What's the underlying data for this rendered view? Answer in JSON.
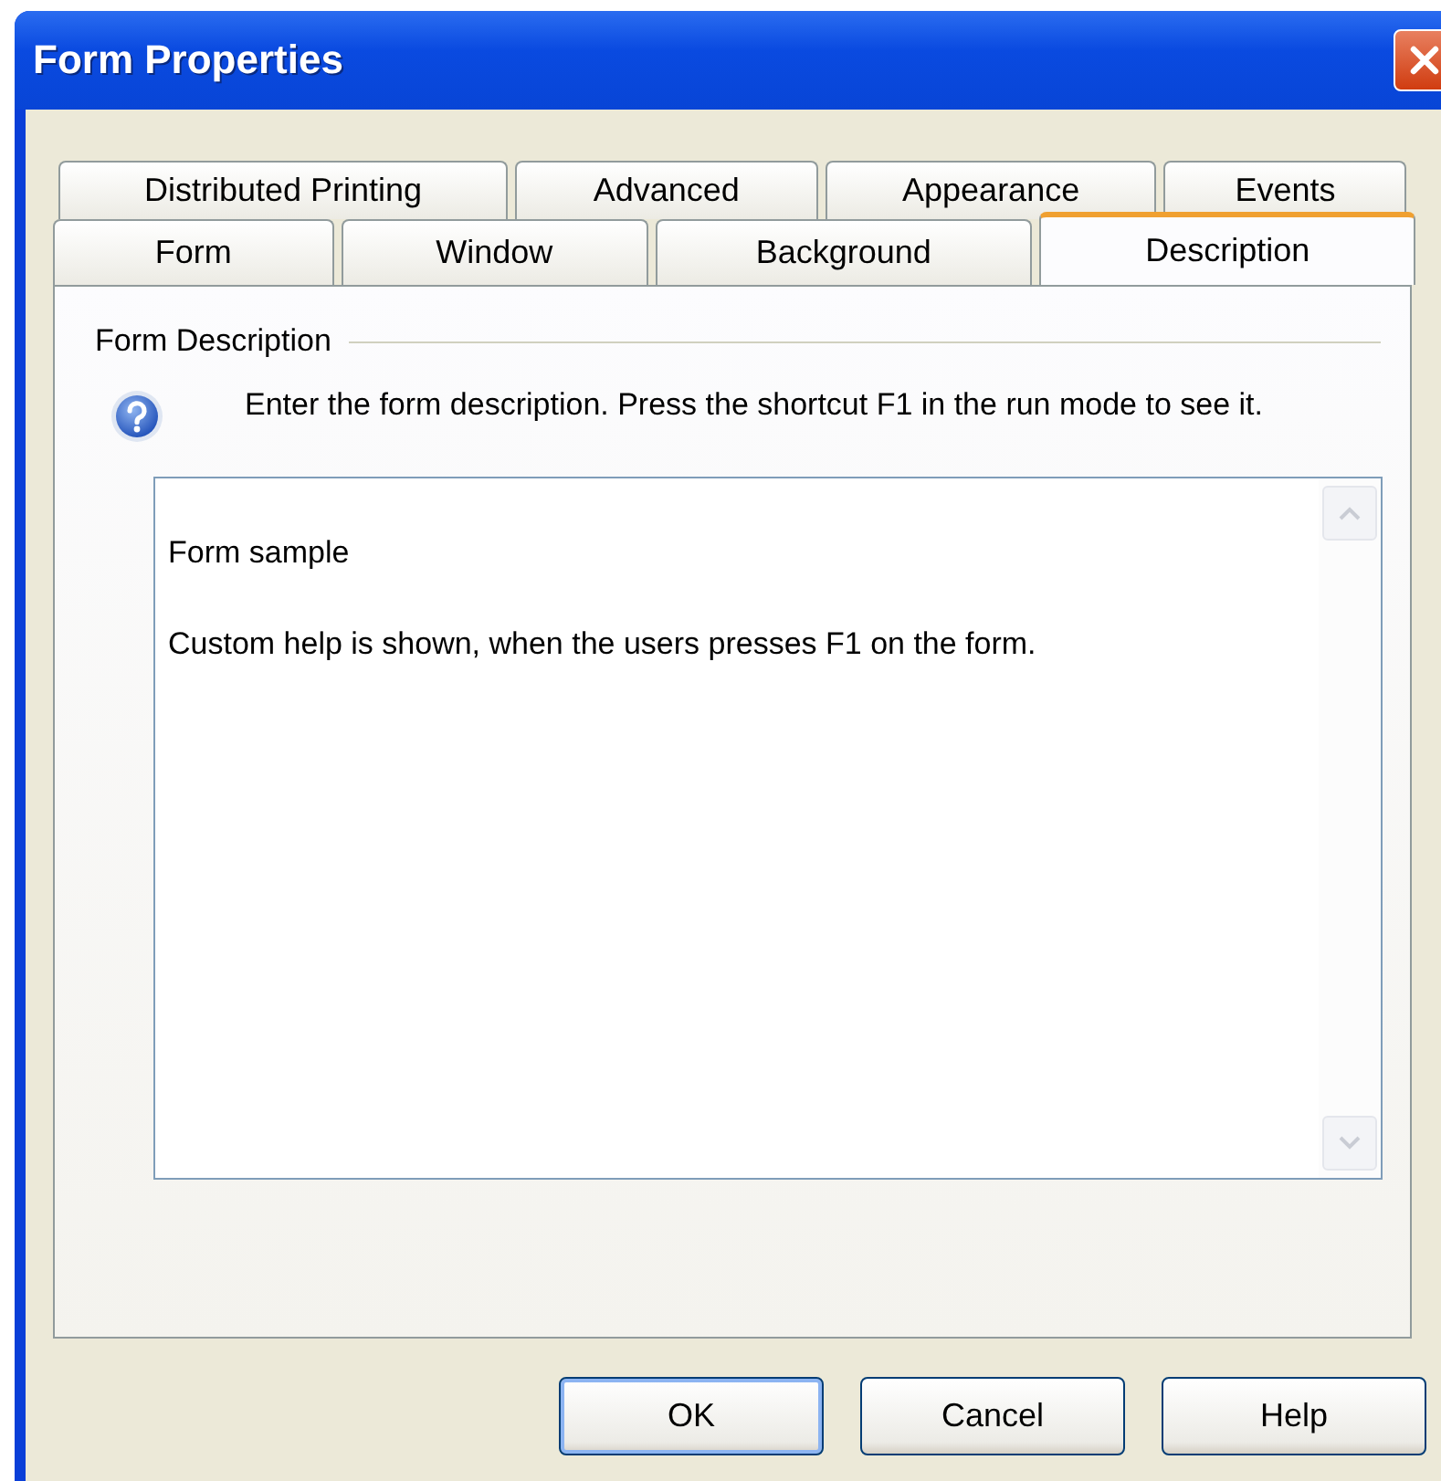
{
  "window": {
    "title": "Form Properties"
  },
  "tab_rows": [
    [
      {
        "label": "Distributed Printing",
        "selected": false
      },
      {
        "label": "Advanced",
        "selected": false
      },
      {
        "label": "Appearance",
        "selected": false
      },
      {
        "label": "Events",
        "selected": false
      }
    ],
    [
      {
        "label": "Form",
        "selected": false
      },
      {
        "label": "Window",
        "selected": false
      },
      {
        "label": "Background",
        "selected": false
      },
      {
        "label": "Description",
        "selected": true
      }
    ]
  ],
  "group": {
    "title": "Form Description",
    "hint": "Enter the form description. Press the shortcut F1 in the run mode to see it."
  },
  "description": {
    "lines": [
      "Form sample",
      "Custom help is shown, when the users presses F1 on the form."
    ]
  },
  "buttons": [
    {
      "label": "OK",
      "default": true
    },
    {
      "label": "Cancel",
      "default": false
    },
    {
      "label": "Help",
      "default": false
    }
  ]
}
